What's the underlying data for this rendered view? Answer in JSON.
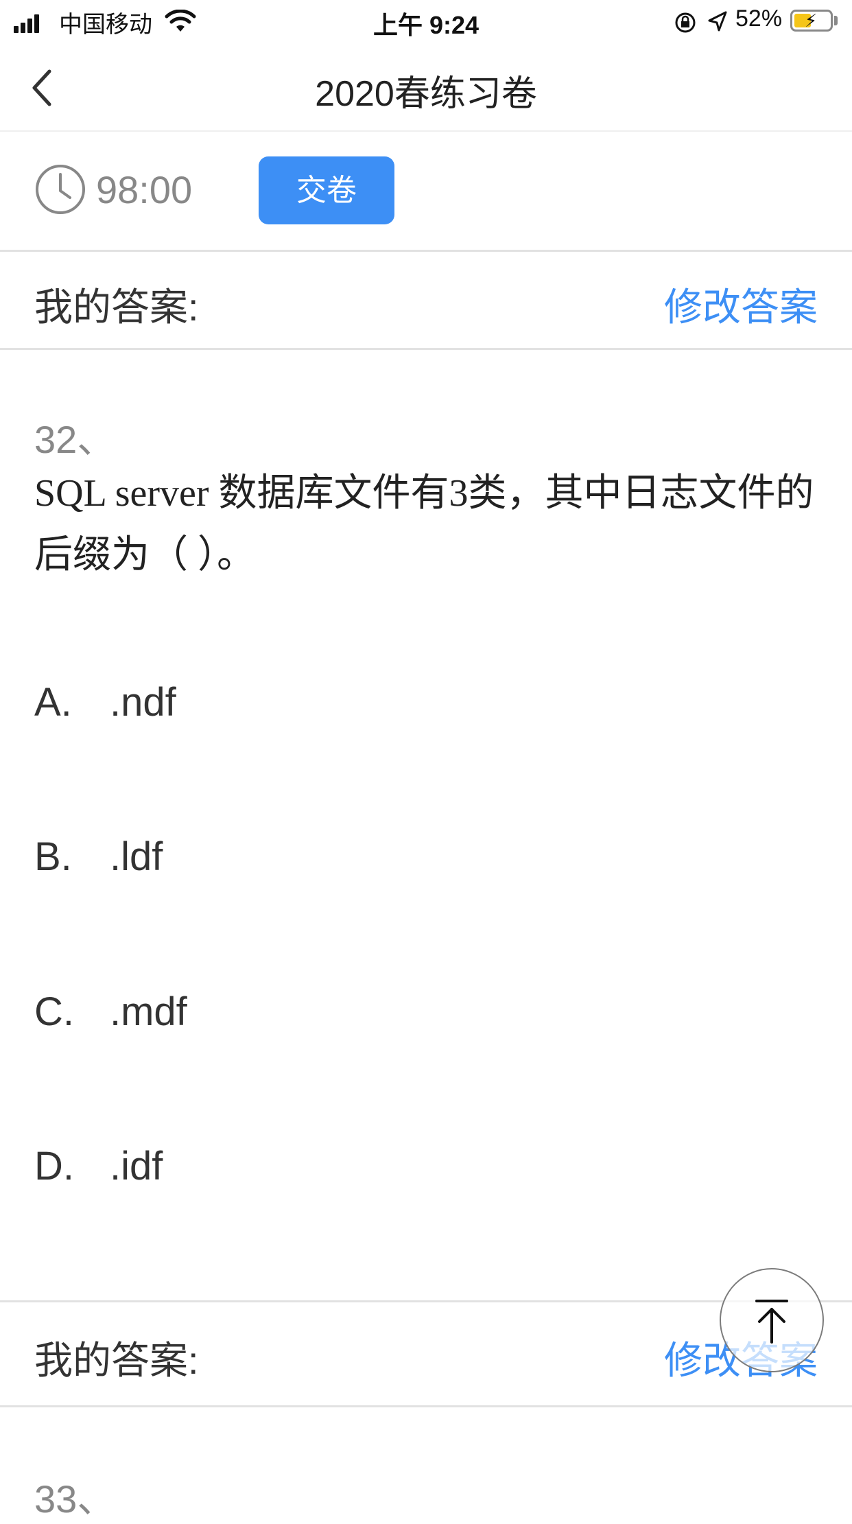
{
  "status_bar": {
    "carrier": "中国移动",
    "time": "上午 9:24",
    "battery_percent": "52%",
    "icons": [
      "signal-icon",
      "wifi-icon",
      "orientation-lock-icon",
      "location-icon",
      "battery-icon"
    ]
  },
  "nav": {
    "title": "2020春练习卷",
    "back_icon": "chevron-left-icon"
  },
  "exam": {
    "timer": "98:00",
    "timer_icon": "clock-icon",
    "submit_label": "交卷"
  },
  "answer_bar": {
    "label": "我的答案:",
    "modify_label": "修改答案"
  },
  "questions": [
    {
      "number": "32、",
      "text": " SQL server 数据库文件有3类，其中日志文件的后缀为（ ）。",
      "options": [
        {
          "letter": "A.",
          "text": ".ndf"
        },
        {
          "letter": "B.",
          "text": ".ldf"
        },
        {
          "letter": "C.",
          "text": ".mdf"
        },
        {
          "letter": "D.",
          "text": ".idf"
        }
      ]
    },
    {
      "number": "33、"
    }
  ],
  "scroll_top_icon": "arrow-up-to-top-icon",
  "colors": {
    "accent": "#3d8ff5",
    "battery_fill": "#f5c518",
    "muted_text": "#888888"
  }
}
